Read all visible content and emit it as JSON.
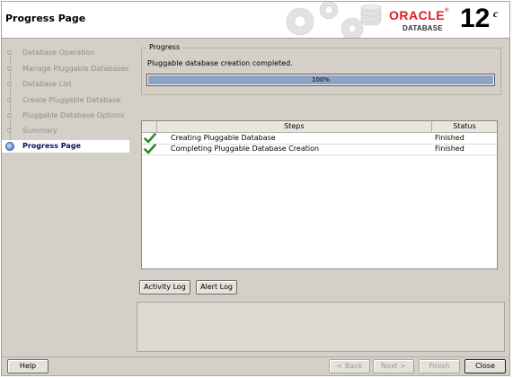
{
  "window": {
    "page_title": "Progress Page",
    "brand": {
      "oracle": "ORACLE",
      "product": "DATABASE",
      "version_number": "12",
      "version_suffix": "c",
      "brand_color": "#e01b22"
    }
  },
  "sidebar": {
    "items": [
      {
        "label": "Database Operation",
        "state": "done"
      },
      {
        "label": "Manage Pluggable Databases",
        "state": "done"
      },
      {
        "label": "Database List",
        "state": "done"
      },
      {
        "label": "Create Pluggable Database",
        "state": "done"
      },
      {
        "label": "Pluggable Database Options",
        "state": "done"
      },
      {
        "label": "Summary",
        "state": "done"
      },
      {
        "label": "Progress Page",
        "state": "active"
      }
    ]
  },
  "progress": {
    "group_title": "Progress",
    "message": "Pluggable database creation completed.",
    "percent_label": "100%",
    "percent_value": 100
  },
  "steps_table": {
    "headers": {
      "steps": "Steps",
      "status": "Status"
    },
    "rows": [
      {
        "step": "Creating Pluggable Database",
        "status": "Finished",
        "icon": "check-icon"
      },
      {
        "step": "Completing Pluggable Database Creation",
        "status": "Finished",
        "icon": "check-icon"
      }
    ]
  },
  "buttons": {
    "activity_log": "Activity Log",
    "alert_log": "Alert Log",
    "help": "Help",
    "back": "< Back",
    "next": "Next >",
    "finish": "Finish",
    "close": "Close"
  }
}
